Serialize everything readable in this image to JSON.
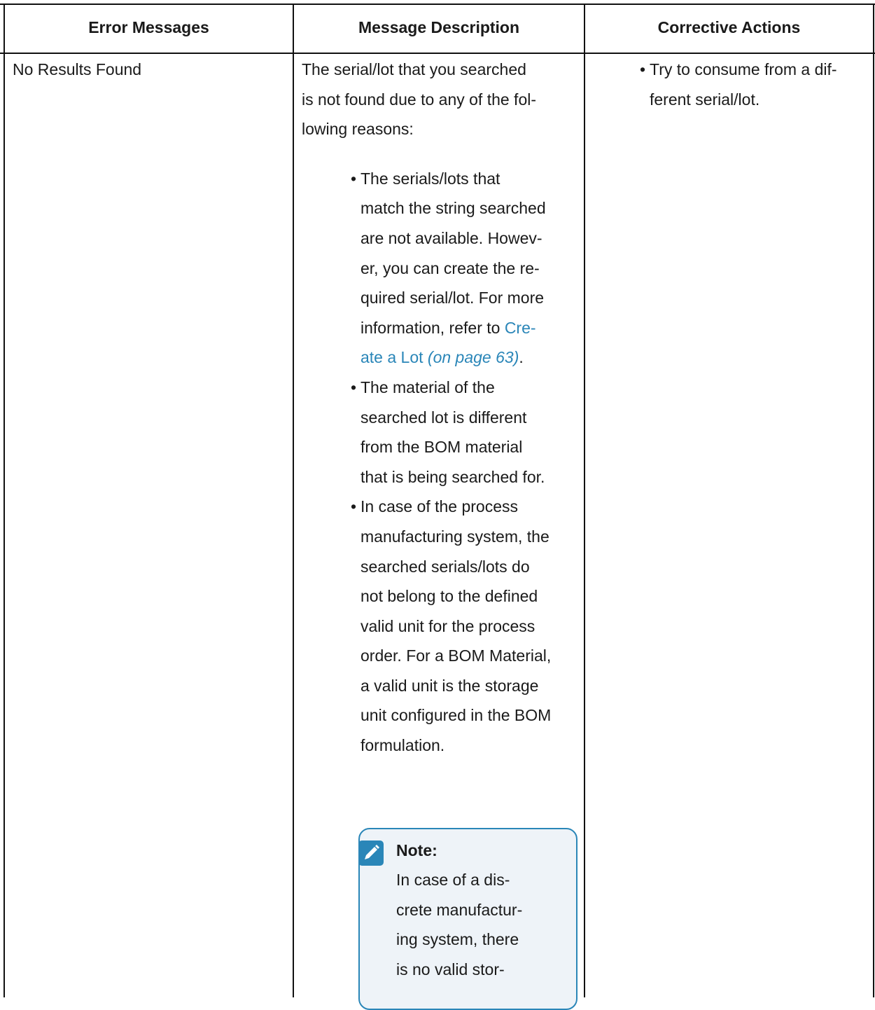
{
  "table": {
    "headers": [
      "Error Messages",
      "Message Description",
      "Corrective Actions"
    ],
    "row": {
      "error_message": "No Results Found",
      "description": {
        "intro_lines": [
          "The serial/lot that you searched",
          "is not found due to any of the fol-",
          "lowing reasons:"
        ],
        "bullet_1_lines_a": [
          "The serials/lots that",
          "match the string searched",
          "are not available. Howev-",
          "er, you can create the re-",
          "quired serial/lot. For more"
        ],
        "bullet_1_line_link_prefix": "information, refer to ",
        "link_part_1": "Cre-",
        "link_part_2": "ate a Lot",
        "link_page_ref": "(on page 63)",
        "link_suffix": ".",
        "bullet_2_lines": [
          "The material of the",
          "searched lot is different",
          "from the BOM material",
          "that is being searched for."
        ],
        "bullet_3_lines": [
          "In case of the process",
          "manufacturing system, the",
          "searched serials/lots do",
          "not belong to the defined",
          "valid unit for the process",
          "order. For a BOM Material,",
          "a valid unit is the storage",
          "unit configured in the BOM",
          "formulation."
        ],
        "note": {
          "title": "Note:",
          "lines": [
            "In case of a dis-",
            "crete manufactur-",
            "ing system, there",
            "is no valid stor-"
          ]
        }
      },
      "corrective_lines": [
        "Try to consume from a dif-",
        "ferent serial/lot."
      ]
    }
  },
  "colors": {
    "link": "#2a86b8",
    "note_bg": "#eef3f8",
    "border": "#111111"
  },
  "icons": {
    "note": "pencil-note-icon",
    "bullet": "•"
  }
}
